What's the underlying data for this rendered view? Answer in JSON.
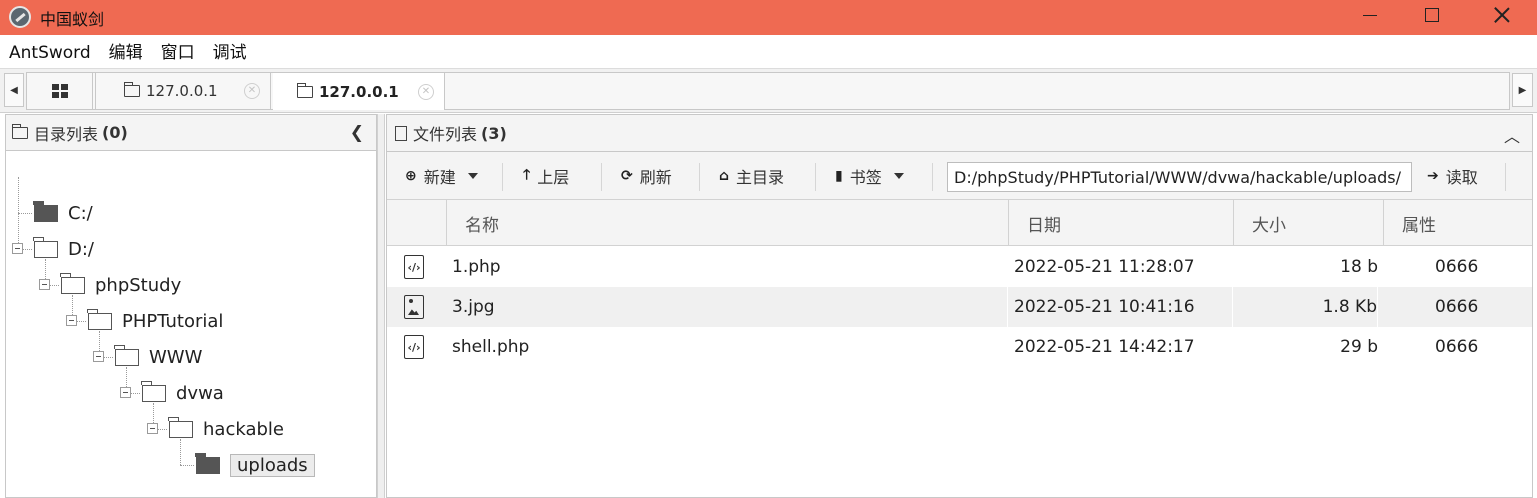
{
  "window": {
    "title": "中国蚁剑"
  },
  "menu": [
    "AntSword",
    "编辑",
    "窗口",
    "调试"
  ],
  "tabs": [
    {
      "label": "127.0.0.1",
      "active": false
    },
    {
      "label": "127.0.0.1",
      "active": true
    }
  ],
  "dir_pane": {
    "title": "目录列表",
    "count": "(0)",
    "tree": [
      "C:/",
      "D:/",
      "phpStudy",
      "PHPTutorial",
      "WWW",
      "dvwa",
      "hackable",
      "uploads"
    ],
    "selected": "uploads"
  },
  "file_pane": {
    "title": "文件列表",
    "count": "(3)",
    "toolbar": {
      "new_label": "新建",
      "up_label": "上层",
      "refresh_label": "刷新",
      "home_label": "主目录",
      "bookmark_label": "书签",
      "path_value": "D:/phpStudy/PHPTutorial/WWW/dvwa/hackable/uploads/",
      "read_label": "读取"
    },
    "columns": [
      "名称",
      "日期",
      "大小",
      "属性"
    ],
    "files": [
      {
        "icon": "code-file-icon",
        "name": "1.php",
        "date": "2022-05-21 11:28:07",
        "size": "18 b",
        "attr": "0666"
      },
      {
        "icon": "image-file-icon",
        "name": "3.jpg",
        "date": "2022-05-21 10:41:16",
        "size": "1.8 Kb",
        "attr": "0666"
      },
      {
        "icon": "code-file-icon",
        "name": "shell.php",
        "date": "2022-05-21 14:42:17",
        "size": "29 b",
        "attr": "0666"
      }
    ]
  },
  "colors": {
    "titlebar": "#ef6a52",
    "selected_row": "#f0f0f0"
  }
}
